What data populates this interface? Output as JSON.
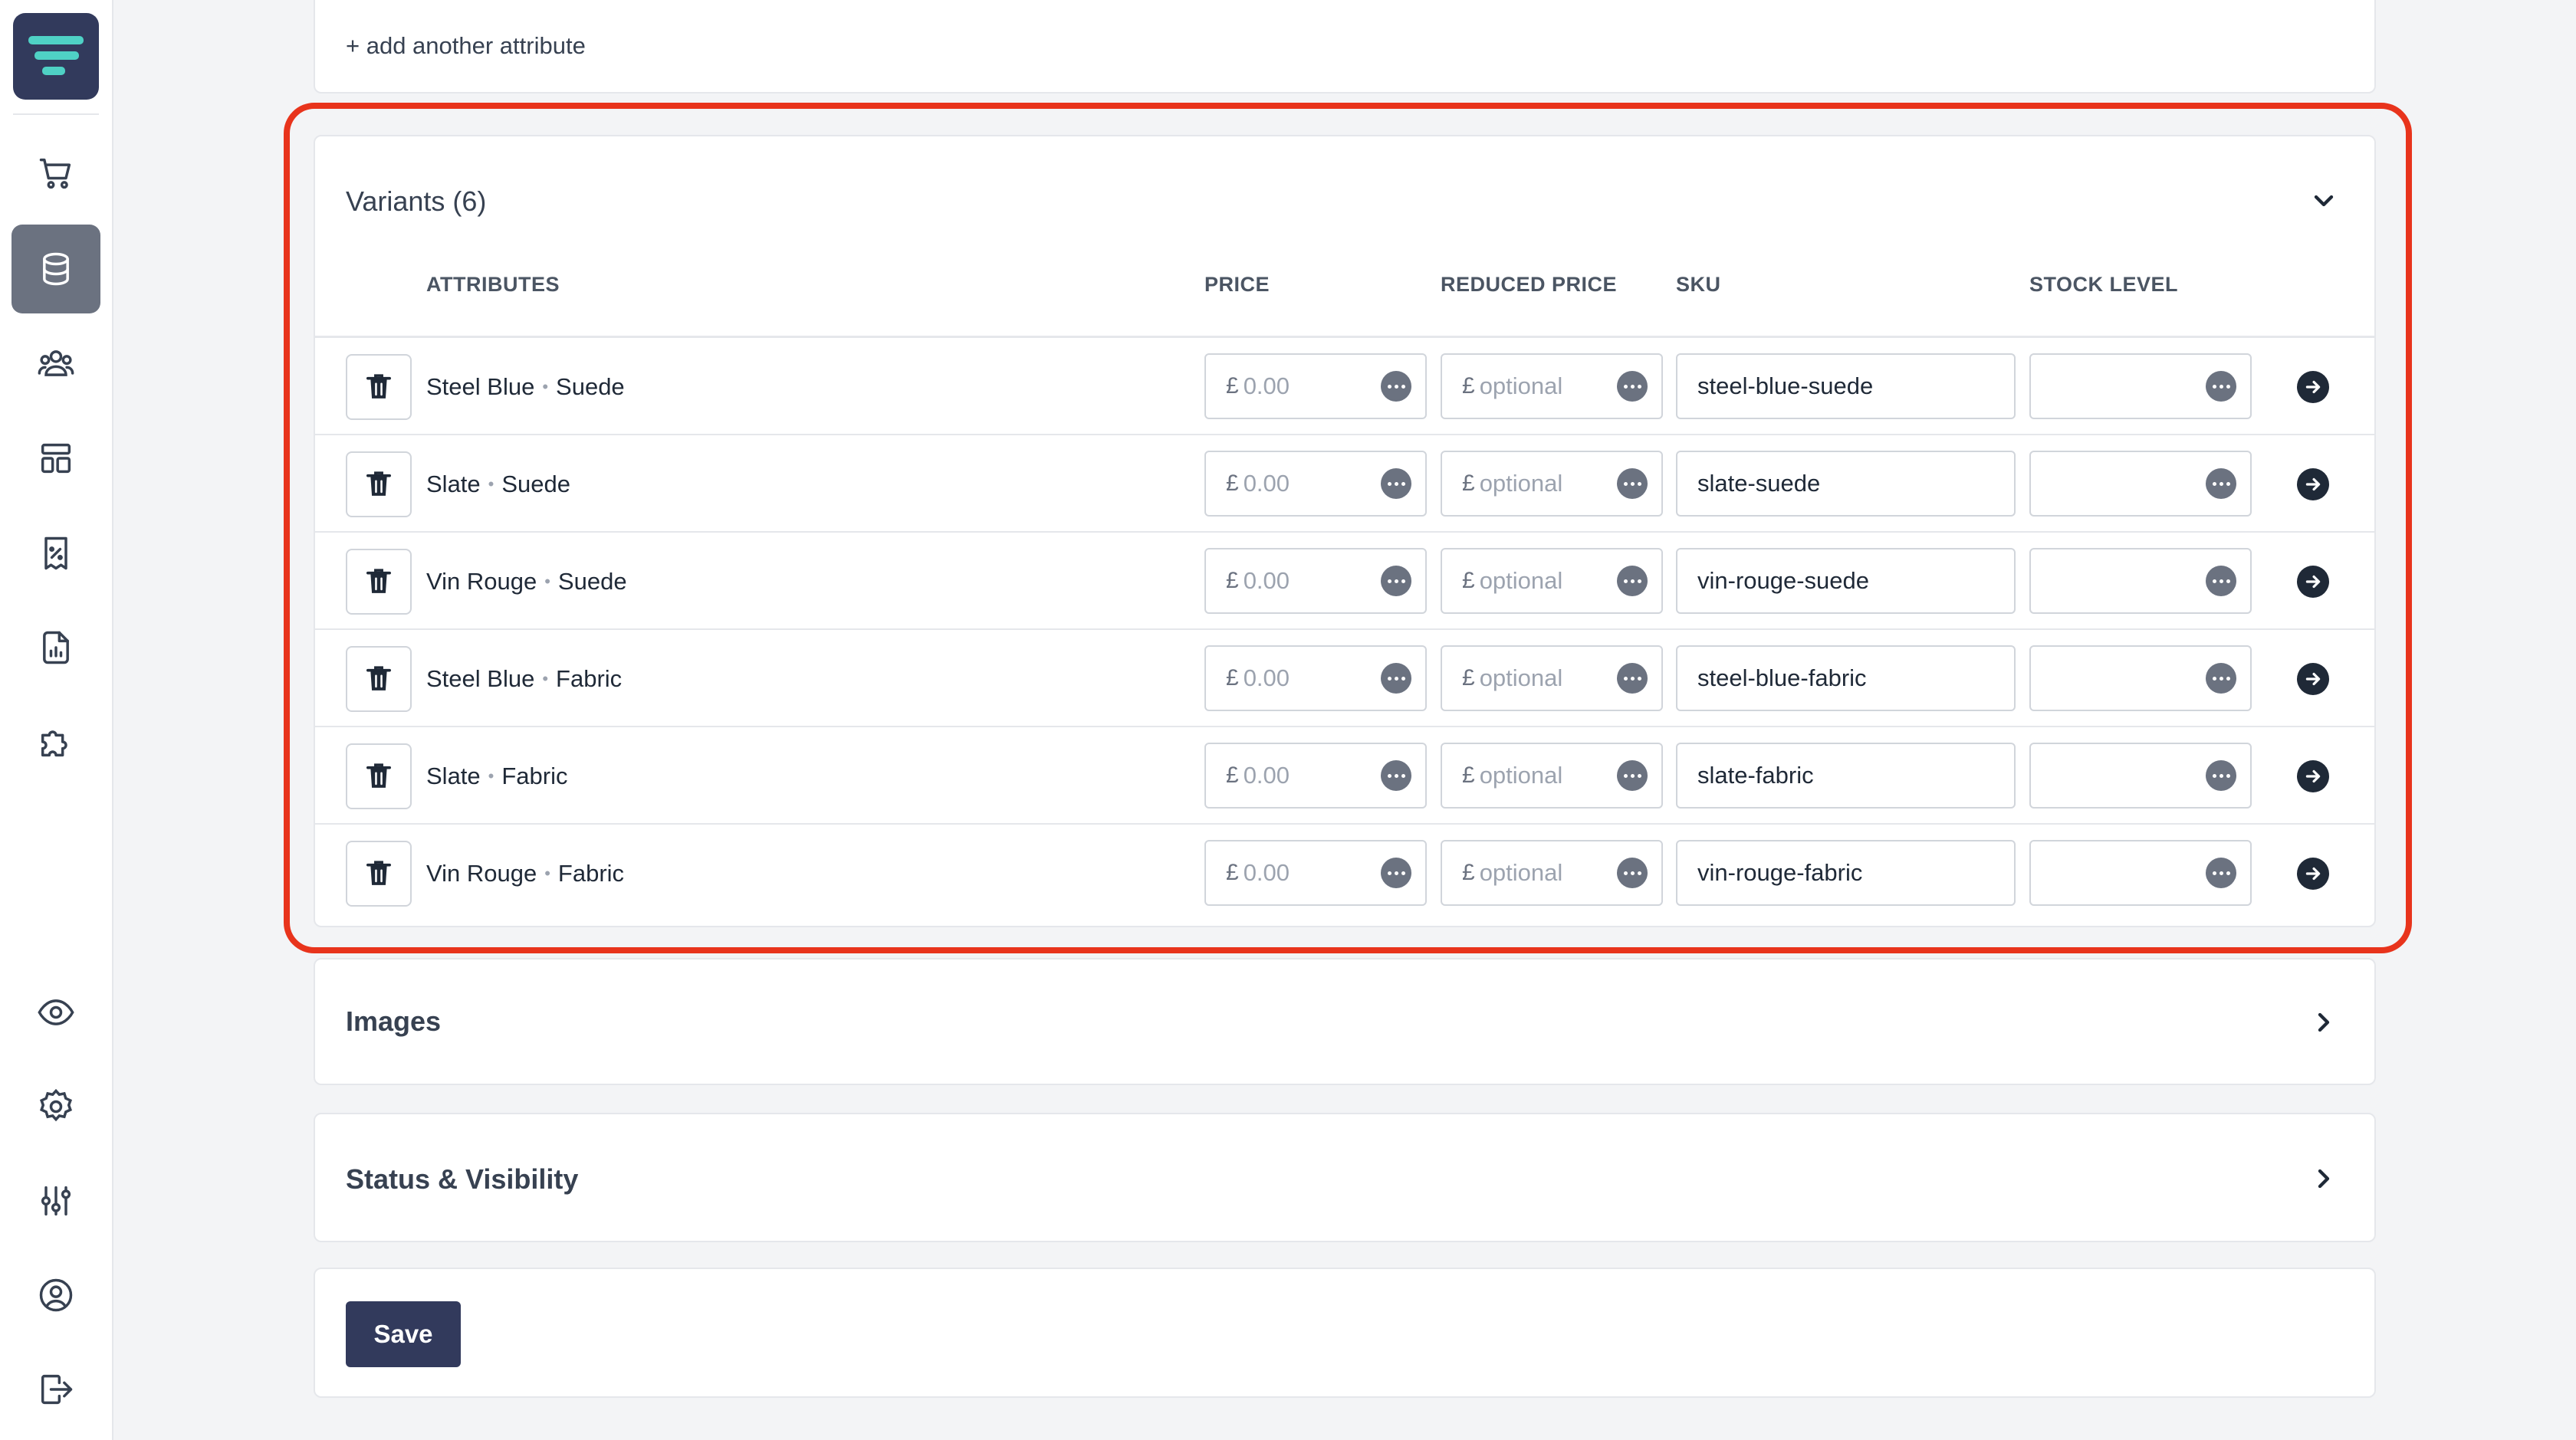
{
  "sidebar": {
    "icons": [
      "logo-icon",
      "cart-icon",
      "database-icon",
      "users-icon",
      "layout-icon",
      "receipt-discount-icon",
      "report-icon",
      "puzzle-icon",
      "eye-icon",
      "settings-icon",
      "sliders-icon",
      "user-circle-icon",
      "logout-icon"
    ],
    "active": "database-icon"
  },
  "attributes_card": {
    "add_link": "+ add another attribute"
  },
  "variants": {
    "title": "Variants (6)",
    "columns": {
      "attributes": "ATTRIBUTES",
      "price": "PRICE",
      "reduced_price": "REDUCED PRICE",
      "sku": "SKU",
      "stock_level": "STOCK LEVEL"
    },
    "currency": "£",
    "price_placeholder": "0.00",
    "reduced_placeholder": "optional",
    "rows": [
      {
        "color": "Steel Blue",
        "material": "Suede",
        "sku": "steel-blue-suede"
      },
      {
        "color": "Slate",
        "material": "Suede",
        "sku": "slate-suede"
      },
      {
        "color": "Vin Rouge",
        "material": "Suede",
        "sku": "vin-rouge-suede"
      },
      {
        "color": "Steel Blue",
        "material": "Fabric",
        "sku": "steel-blue-fabric"
      },
      {
        "color": "Slate",
        "material": "Fabric",
        "sku": "slate-fabric"
      },
      {
        "color": "Vin Rouge",
        "material": "Fabric",
        "sku": "vin-rouge-fabric"
      }
    ]
  },
  "images": {
    "title": "Images"
  },
  "status": {
    "title": "Status & Visibility"
  },
  "actions": {
    "save_label": "Save"
  },
  "colors": {
    "primary": "#323a5c",
    "highlight": "#e8341c"
  }
}
